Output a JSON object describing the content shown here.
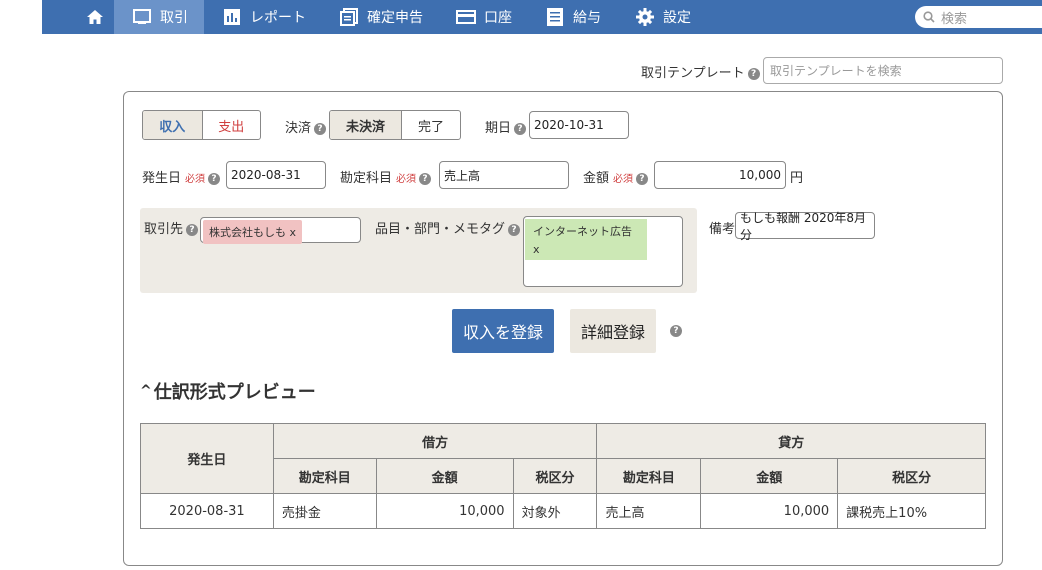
{
  "nav": {
    "items": [
      {
        "label": "取引",
        "icon": "transactions-icon"
      },
      {
        "label": "レポート",
        "icon": "report-icon"
      },
      {
        "label": "確定申告",
        "icon": "tax-return-icon"
      },
      {
        "label": "口座",
        "icon": "account-icon"
      },
      {
        "label": "給与",
        "icon": "payroll-icon"
      },
      {
        "label": "設定",
        "icon": "gear-icon"
      }
    ],
    "search_placeholder": "検索"
  },
  "template": {
    "label": "取引テンプレート",
    "placeholder": "取引テンプレートを検索"
  },
  "form": {
    "type_income": "収入",
    "type_expense": "支出",
    "settlement_label": "決済",
    "unsettled": "未決済",
    "settled": "完了",
    "due_label": "期日",
    "due_value": "2020-10-31",
    "issue_label": "発生日",
    "required": "必須",
    "issue_value": "2020-08-31",
    "account_label": "勘定科目",
    "account_value": "売上高",
    "amount_label": "金額",
    "amount_value": "10,000",
    "currency": "円",
    "partner_label": "取引先",
    "partner_tag": "株式会社もしも",
    "tag_remove": "x",
    "items_label": "品目・部門・メモタグ",
    "memo_tag": "インターネット広告",
    "remarks_label": "備考",
    "remarks_value": "もしも報酬 2020年8月分"
  },
  "actions": {
    "register": "収入を登録",
    "detail": "詳細登録"
  },
  "preview": {
    "toggle": "^",
    "title": "仕訳形式プレビュー",
    "headers": {
      "date": "発生日",
      "debit": "借方",
      "credit": "貸方",
      "account": "勘定科目",
      "amount": "金額",
      "tax": "税区分"
    },
    "row": {
      "date": "2020-08-31",
      "debit_account": "売掛金",
      "debit_amount": "10,000",
      "debit_tax": "対象外",
      "credit_account": "売上高",
      "credit_amount": "10,000",
      "credit_tax": "課税売上10%"
    }
  }
}
